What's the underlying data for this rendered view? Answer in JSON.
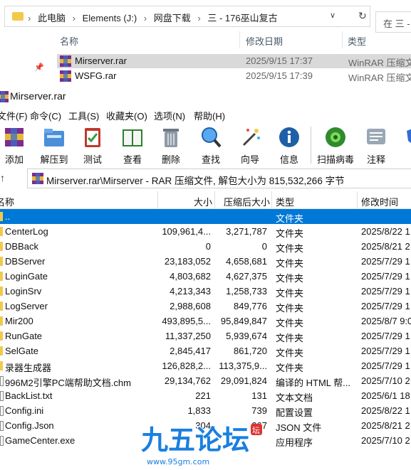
{
  "explorer": {
    "path": [
      "此电脑",
      "Elements (J:)",
      "网盘下载",
      "三 - 176巫山复古"
    ],
    "search_placeholder": "在 三 -",
    "columns": {
      "name": "名称",
      "date": "修改日期",
      "type": "类型"
    },
    "files": [
      {
        "name": "Mirserver.rar",
        "date": "2025/9/15 17:37",
        "type": "WinRAR 压缩文..."
      },
      {
        "name": "WSFG.rar",
        "date": "2025/9/15 17:39",
        "type": "WinRAR 压缩文..."
      }
    ]
  },
  "winrar": {
    "title": "Mirserver.rar",
    "menu": [
      "文件(F)",
      "命令(C)",
      "工具(S)",
      "收藏夹(O)",
      "选项(N)",
      "帮助(H)"
    ],
    "toolbar": [
      "添加",
      "解压到",
      "测试",
      "查看",
      "删除",
      "查找",
      "向导",
      "信息",
      "扫描病毒",
      "注释",
      "保"
    ],
    "path": "Mirserver.rar\\Mirserver - RAR 压缩文件, 解包大小为 815,532,266 字节",
    "columns": {
      "name": "名称",
      "size": "大小",
      "packed": "压缩后大小",
      "type": "类型",
      "modified": "修改时间"
    },
    "rows": [
      {
        "name": "..",
        "size": "",
        "packed": "",
        "type": "文件夹",
        "modified": "",
        "kind": "folder",
        "selected": true
      },
      {
        "name": "CenterLog",
        "size": "109,961,4...",
        "packed": "3,271,787",
        "type": "文件夹",
        "modified": "2025/8/22 1",
        "kind": "folder"
      },
      {
        "name": "DBBack",
        "size": "0",
        "packed": "0",
        "type": "文件夹",
        "modified": "2025/8/21 2",
        "kind": "folder"
      },
      {
        "name": "DBServer",
        "size": "23,183,052",
        "packed": "4,658,681",
        "type": "文件夹",
        "modified": "2025/7/29 1",
        "kind": "folder"
      },
      {
        "name": "LoginGate",
        "size": "4,803,682",
        "packed": "4,627,375",
        "type": "文件夹",
        "modified": "2025/7/29 1",
        "kind": "folder"
      },
      {
        "name": "LoginSrv",
        "size": "4,213,343",
        "packed": "1,258,733",
        "type": "文件夹",
        "modified": "2025/7/29 1",
        "kind": "folder"
      },
      {
        "name": "LogServer",
        "size": "2,988,608",
        "packed": "849,776",
        "type": "文件夹",
        "modified": "2025/7/29 1",
        "kind": "folder"
      },
      {
        "name": "Mir200",
        "size": "493,895,5...",
        "packed": "95,849,847",
        "type": "文件夹",
        "modified": "2025/8/7 9:0",
        "kind": "folder"
      },
      {
        "name": "RunGate",
        "size": "11,337,250",
        "packed": "5,939,674",
        "type": "文件夹",
        "modified": "2025/7/29 1",
        "kind": "folder"
      },
      {
        "name": "SelGate",
        "size": "2,845,417",
        "packed": "861,720",
        "type": "文件夹",
        "modified": "2025/7/29 1",
        "kind": "folder"
      },
      {
        "name": "录器生成器",
        "size": "126,828,2...",
        "packed": "113,375,9...",
        "type": "文件夹",
        "modified": "2025/7/29 1",
        "kind": "folder"
      },
      {
        "name": "996M2引擎PC端帮助文档.chm",
        "size": "29,134,762",
        "packed": "29,091,824",
        "type": "编译的 HTML 帮...",
        "modified": "2025/7/10 2",
        "kind": "file"
      },
      {
        "name": "BackList.txt",
        "size": "221",
        "packed": "131",
        "type": "文本文档",
        "modified": "2025/6/1 18",
        "kind": "file"
      },
      {
        "name": "Config.ini",
        "size": "1,833",
        "packed": "739",
        "type": "配置设置",
        "modified": "2025/8/22 1",
        "kind": "file"
      },
      {
        "name": "Config.Json",
        "size": "304",
        "packed": "267",
        "type": "JSON 文件",
        "modified": "2025/8/21 2",
        "kind": "file"
      },
      {
        "name": "GameCenter.exe",
        "size": "",
        "packed": "",
        "type": "应用程序",
        "modified": "2025/7/10 2",
        "kind": "file"
      }
    ]
  },
  "watermark": {
    "text": "九五论坛",
    "url": "www.95gm.com"
  },
  "colors": {
    "selection": "#0078d7",
    "watermark": "#1a7fe0"
  }
}
